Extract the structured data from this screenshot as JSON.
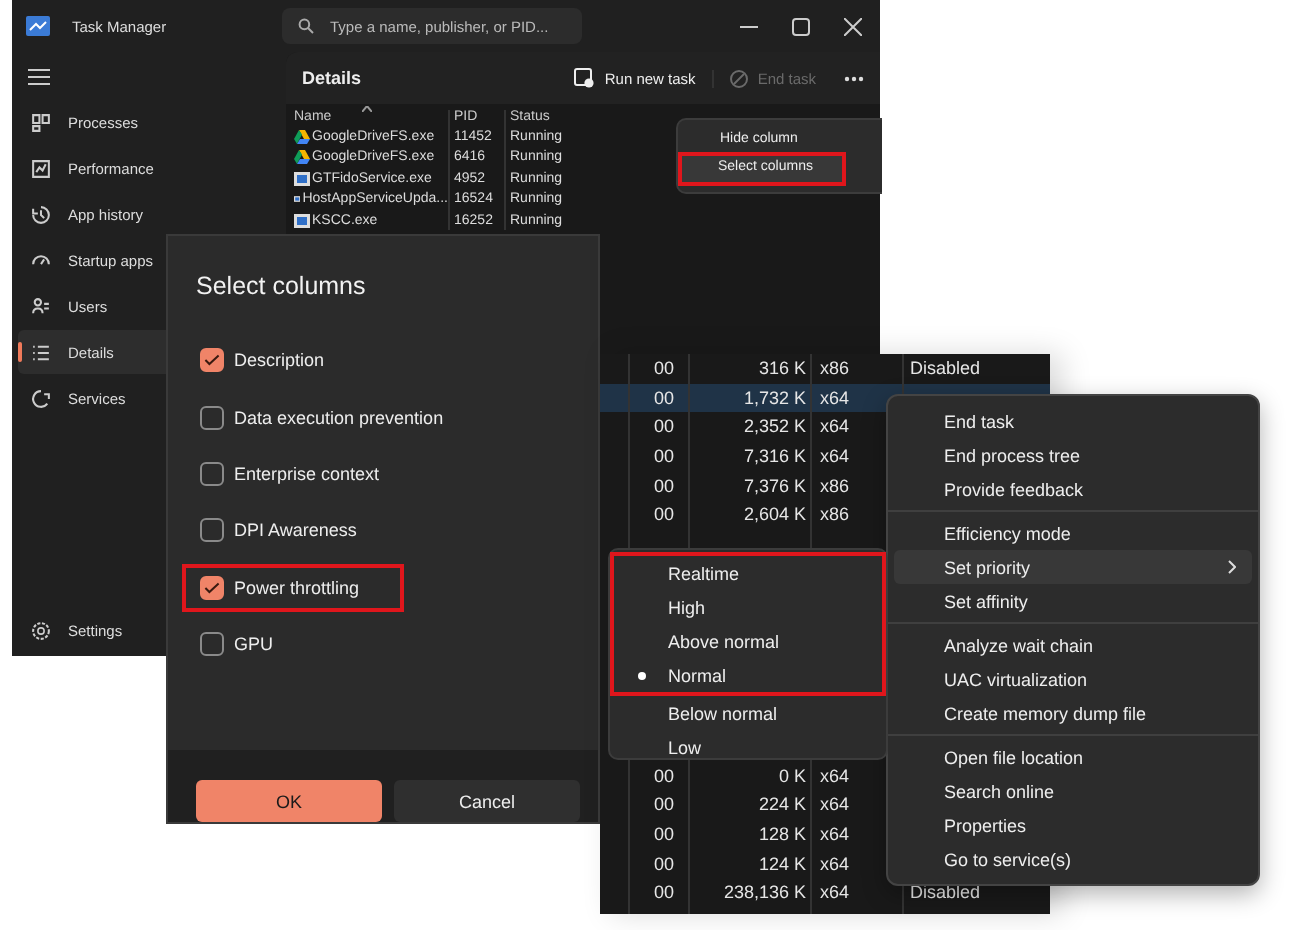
{
  "window": {
    "title": "Task Manager",
    "search": {
      "placeholder": "Type a name, publisher, or PID..."
    }
  },
  "sidebar": {
    "items": [
      {
        "label": "Processes",
        "selected": false
      },
      {
        "label": "Performance",
        "selected": false
      },
      {
        "label": "App history",
        "selected": false
      },
      {
        "label": "Startup apps",
        "selected": false
      },
      {
        "label": "Users",
        "selected": false
      },
      {
        "label": "Details",
        "selected": true
      },
      {
        "label": "Services",
        "selected": false
      }
    ],
    "footer": {
      "label": "Settings"
    }
  },
  "details": {
    "title": "Details",
    "toolbar": [
      {
        "label": "Run new task",
        "disabled": false
      },
      {
        "label": "End task",
        "disabled": true
      }
    ],
    "table": {
      "columns": [
        "Name",
        "PID",
        "Status"
      ],
      "rows": [
        {
          "kind": "drive",
          "name": "GoogleDriveFS.exe",
          "pid": "11452",
          "status": "Running"
        },
        {
          "kind": "drive",
          "name": "GoogleDriveFS.exe",
          "pid": "6416",
          "status": "Running"
        },
        {
          "kind": "app",
          "name": "GTFidoService.exe",
          "pid": "4952",
          "status": "Running"
        },
        {
          "kind": "app",
          "name": "HostAppServiceUpda...",
          "pid": "16524",
          "status": "Running"
        },
        {
          "kind": "app",
          "name": "KSCC.exe",
          "pid": "16252",
          "status": "Running"
        }
      ]
    }
  },
  "column_menu": {
    "items": [
      {
        "label": "Hide column",
        "hovered": false,
        "annotated": false
      },
      {
        "label": "Select columns",
        "hovered": true,
        "annotated": true
      }
    ]
  },
  "dialog": {
    "title": "Select columns",
    "options": [
      {
        "label": "Description",
        "checked": true,
        "annotated": false
      },
      {
        "label": "Data execution prevention",
        "checked": false,
        "annotated": false
      },
      {
        "label": "Enterprise context",
        "checked": false,
        "annotated": false
      },
      {
        "label": "DPI Awareness",
        "checked": false,
        "annotated": false
      },
      {
        "label": "Power throttling",
        "checked": true,
        "annotated": true
      },
      {
        "label": "GPU",
        "checked": false,
        "annotated": false
      }
    ],
    "buttons": [
      {
        "label": "OK",
        "primary": true
      },
      {
        "label": "Cancel",
        "primary": false
      }
    ]
  },
  "process_table": {
    "upper_rows": [
      {
        "column_1": "00",
        "column_2": "316 K",
        "column_3": "x86",
        "column_4": "Disabled",
        "selected": false
      },
      {
        "column_1": "00",
        "column_2": "1,732 K",
        "column_3": "x64",
        "selected": true
      },
      {
        "column_1": "00",
        "column_2": "2,352 K",
        "column_3": "x64",
        "selected": false
      },
      {
        "column_1": "00",
        "column_2": "7,316 K",
        "column_3": "x64",
        "selected": false
      },
      {
        "column_1": "00",
        "column_2": "7,376 K",
        "column_3": "x86",
        "selected": false
      },
      {
        "column_1": "00",
        "column_2": "2,604 K",
        "column_3": "x86",
        "selected": false
      }
    ],
    "lower_rows": [
      {
        "column_1": "00",
        "column_2": "0 K",
        "column_3": "x64",
        "selected": false
      },
      {
        "column_1": "00",
        "column_2": "224 K",
        "column_3": "x64",
        "selected": false
      },
      {
        "column_1": "00",
        "column_2": "128 K",
        "column_3": "x64",
        "selected": false
      },
      {
        "column_1": "00",
        "column_2": "124 K",
        "column_3": "x64",
        "selected": false
      },
      {
        "column_1": "00",
        "column_2": "238,136 K",
        "column_3": "x64",
        "column_4": "Disabled",
        "selected": false
      }
    ]
  },
  "context_menu": {
    "groups": [
      [
        {
          "label": "End task",
          "hovered": false,
          "has_submenu": false
        },
        {
          "label": "End process tree",
          "hovered": false,
          "has_submenu": false
        },
        {
          "label": "Provide feedback",
          "hovered": false,
          "has_submenu": false
        }
      ],
      [
        {
          "label": "Efficiency mode",
          "hovered": false,
          "has_submenu": false
        },
        {
          "label": "Set priority",
          "hovered": true,
          "has_submenu": true
        },
        {
          "label": "Set affinity",
          "hovered": false,
          "has_submenu": false
        }
      ],
      [
        {
          "label": "Analyze wait chain",
          "hovered": false,
          "has_submenu": false
        },
        {
          "label": "UAC virtualization",
          "hovered": false,
          "has_submenu": false
        },
        {
          "label": "Create memory dump file",
          "hovered": false,
          "has_submenu": false
        }
      ],
      [
        {
          "label": "Open file location",
          "hovered": false,
          "has_submenu": false
        },
        {
          "label": "Search online",
          "hovered": false,
          "has_submenu": false
        },
        {
          "label": "Properties",
          "hovered": false,
          "has_submenu": false
        },
        {
          "label": "Go to service(s)",
          "hovered": false,
          "has_submenu": false
        }
      ]
    ]
  },
  "priority_menu": {
    "items": [
      {
        "label": "Realtime",
        "selected": false,
        "annotated": true
      },
      {
        "label": "High",
        "selected": false,
        "annotated": true
      },
      {
        "label": "Above normal",
        "selected": false,
        "annotated": true
      },
      {
        "label": "Normal",
        "selected": true,
        "annotated": true
      },
      {
        "label": "Below normal",
        "selected": false,
        "annotated": false
      },
      {
        "label": "Low",
        "selected": false,
        "annotated": false
      }
    ]
  }
}
